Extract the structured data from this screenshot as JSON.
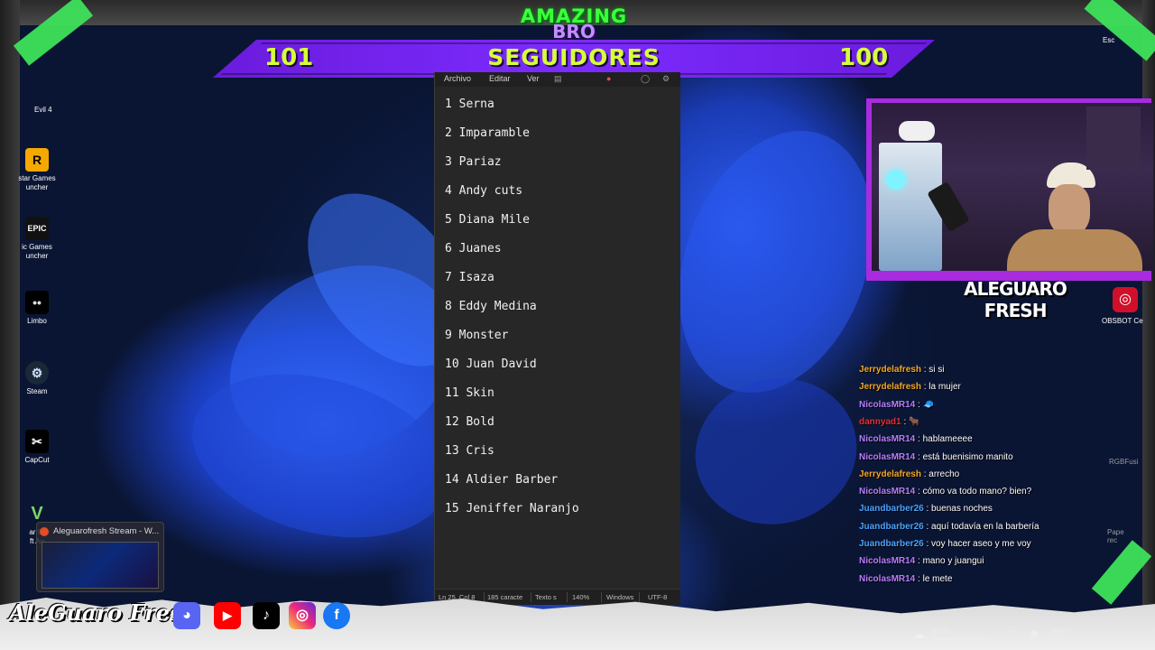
{
  "overlay": {
    "brand_top": "AMAZING",
    "brand_bottom": "BRO",
    "followers_left": "101",
    "followers_label": "SEGUIDORES",
    "followers_right": "100",
    "streamer_name": "ALEGUARO FRESH",
    "social_name": "AleGuaro Fresh",
    "social_icons": [
      "discord-icon",
      "youtube-icon",
      "tiktok-icon",
      "instagram-icon",
      "facebook-icon"
    ],
    "accent_green": "#3cff3c",
    "accent_purple": "#7d2cff",
    "accent_yellow": "#d6ff3a"
  },
  "desktop": {
    "icons": [
      {
        "label": "Evil 4",
        "icon": "game-icon"
      },
      {
        "label": "star Games\nuncher",
        "icon": "rockstar-icon"
      },
      {
        "label": "ic Games\nuncher",
        "icon": "epic-games-icon"
      },
      {
        "label": "Limbo",
        "icon": "limbo-icon"
      },
      {
        "label": "Steam",
        "icon": "steam-icon"
      },
      {
        "label": "CapCut",
        "icon": "capcut-icon"
      },
      {
        "label": "ar Gi\nft Au",
        "icon": "gta-icon"
      }
    ],
    "right_labels": {
      "top": "Esc",
      "obsbot": "OBSBOT Ce",
      "rgb": "RGBFusi",
      "pape": "Pape\nrec"
    }
  },
  "notepad": {
    "menu": [
      "Archivo",
      "Editar",
      "Ver"
    ],
    "lines": [
      "1 Serna",
      "2 Imparamble",
      "3 Pariaz",
      "4 Andy cuts",
      "5 Diana Mile",
      "6 Juanes",
      "7 Isaza",
      "8 Eddy Medina",
      "9 Monster",
      "10 Juan David",
      "11 Skin",
      "12 Bold",
      "13 Cris",
      "14 Aldier Barber",
      "15 Jeniffer Naranjo"
    ],
    "status": {
      "position": "Ln 25, Col 8",
      "chars": "185 caracte",
      "format": "Texto s",
      "zoom": "140%",
      "eol": "Windows",
      "encoding": "UTF-8"
    }
  },
  "chat": {
    "messages": [
      {
        "user": "Jerrydelafresh",
        "color": "#f5a623",
        "text": "si si"
      },
      {
        "user": "Jerrydelafresh",
        "color": "#f5a623",
        "text": "la mujer"
      },
      {
        "user": "NicolasMR14",
        "color": "#b77dff",
        "text": "🧢"
      },
      {
        "user": "dannyad1",
        "color": "#e0303a",
        "text": "🐂"
      },
      {
        "user": "NicolasMR14",
        "color": "#b77dff",
        "text": "hablameeee"
      },
      {
        "user": "NicolasMR14",
        "color": "#b77dff",
        "text": "está buenisimo manito"
      },
      {
        "user": "Jerrydelafresh",
        "color": "#f5a623",
        "text": "arrecho"
      },
      {
        "user": "NicolasMR14",
        "color": "#b77dff",
        "text": "cómo va todo mano? bien?"
      },
      {
        "user": "Juandbarber26",
        "color": "#4aa3ff",
        "text": "buenas noches"
      },
      {
        "user": "Juandbarber26",
        "color": "#4aa3ff",
        "text": "aquí todavía en la barbería"
      },
      {
        "user": "Juandbarber26",
        "color": "#4aa3ff",
        "text": "voy hacer aseo y me voy"
      },
      {
        "user": "NicolasMR14",
        "color": "#b77dff",
        "text": "mano y juangui"
      },
      {
        "user": "NicolasMR14",
        "color": "#b77dff",
        "text": "le mete"
      }
    ]
  },
  "taskbar": {
    "preview_title": "Aleguarofresh Stream - W...",
    "weather_temp": "19°C",
    "weather_desc": "Mayorm. nublado",
    "language": "ESP"
  }
}
